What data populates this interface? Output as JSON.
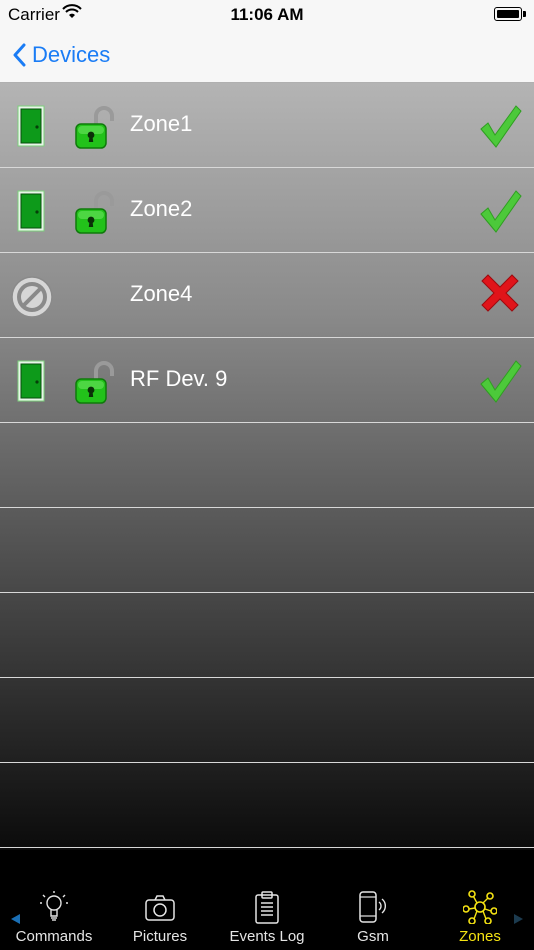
{
  "status_bar": {
    "carrier": "Carrier",
    "time": "11:06 AM"
  },
  "nav": {
    "back_label": "Devices"
  },
  "zones": [
    {
      "name": "Zone1",
      "type": "door",
      "lock": "unlocked",
      "status": "ok"
    },
    {
      "name": "Zone2",
      "type": "door",
      "lock": "unlocked",
      "status": "ok"
    },
    {
      "name": "Zone4",
      "type": "blocked",
      "lock": "none",
      "status": "error"
    },
    {
      "name": "RF Dev. 9",
      "type": "door",
      "lock": "unlocked",
      "status": "ok"
    }
  ],
  "empty_rows": 5,
  "tabs": [
    {
      "label": "Commands",
      "icon": "lightbulb-icon",
      "active": false
    },
    {
      "label": "Pictures",
      "icon": "camera-icon",
      "active": false
    },
    {
      "label": "Events Log",
      "icon": "clipboard-icon",
      "active": false
    },
    {
      "label": "Gsm",
      "icon": "phone-signal-icon",
      "active": false
    },
    {
      "label": "Zones",
      "icon": "network-icon",
      "active": true
    }
  ],
  "colors": {
    "accent_blue": "#1a7cf5",
    "active_tab": "#f5e313",
    "ok_green": "#4cc93a",
    "error_red": "#e0141a",
    "door_green": "#10a21b"
  }
}
